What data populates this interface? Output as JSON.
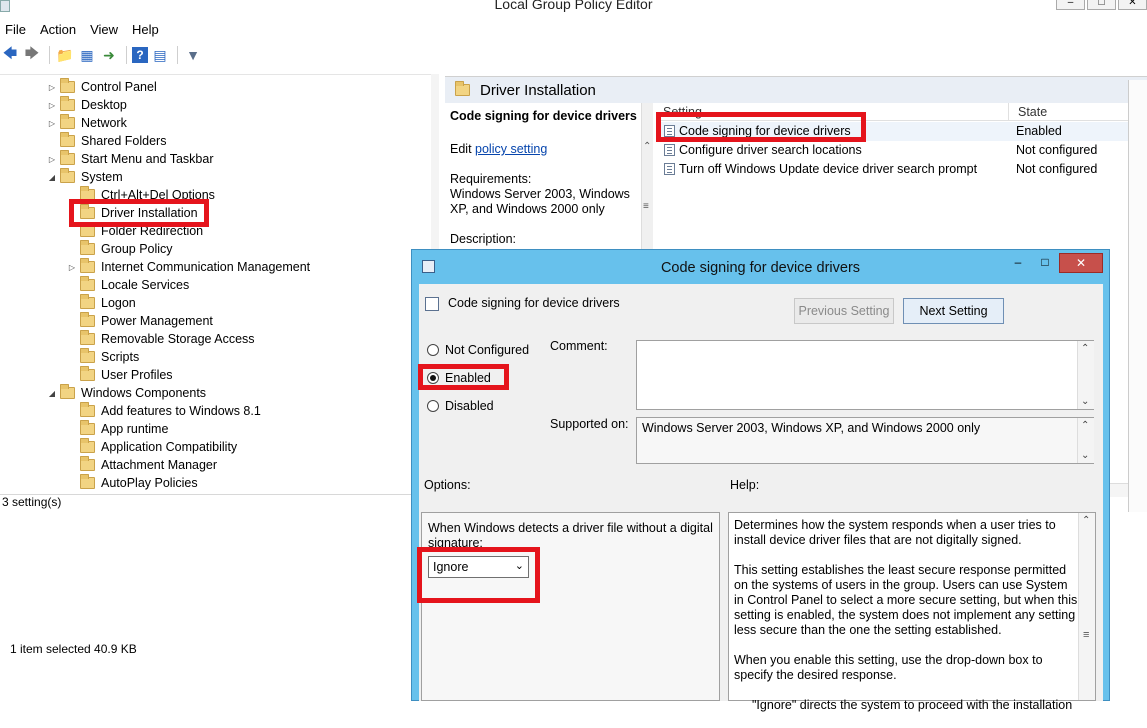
{
  "window": {
    "title": "Local Group Policy Editor"
  },
  "menu": [
    "File",
    "Action",
    "View",
    "Help"
  ],
  "tree": {
    "items": [
      {
        "label": "Control Panel",
        "indent": 0,
        "arrow": "closed"
      },
      {
        "label": "Desktop",
        "indent": 0,
        "arrow": "closed"
      },
      {
        "label": "Network",
        "indent": 0,
        "arrow": "closed"
      },
      {
        "label": "Shared Folders",
        "indent": 0,
        "arrow": "none"
      },
      {
        "label": "Start Menu and Taskbar",
        "indent": 0,
        "arrow": "closed"
      },
      {
        "label": "System",
        "indent": 0,
        "arrow": "open"
      },
      {
        "label": "Ctrl+Alt+Del Options",
        "indent": 1,
        "arrow": "none"
      },
      {
        "label": "Driver Installation",
        "indent": 1,
        "arrow": "none"
      },
      {
        "label": "Folder Redirection",
        "indent": 1,
        "arrow": "none"
      },
      {
        "label": "Group Policy",
        "indent": 1,
        "arrow": "none"
      },
      {
        "label": "Internet Communication Management",
        "indent": 1,
        "arrow": "closed"
      },
      {
        "label": "Locale Services",
        "indent": 1,
        "arrow": "none"
      },
      {
        "label": "Logon",
        "indent": 1,
        "arrow": "none"
      },
      {
        "label": "Power Management",
        "indent": 1,
        "arrow": "none"
      },
      {
        "label": "Removable Storage Access",
        "indent": 1,
        "arrow": "none"
      },
      {
        "label": "Scripts",
        "indent": 1,
        "arrow": "none"
      },
      {
        "label": "User Profiles",
        "indent": 1,
        "arrow": "none"
      },
      {
        "label": "Windows Components",
        "indent": 0,
        "arrow": "open"
      },
      {
        "label": "Add features to Windows 8.1",
        "indent": 1,
        "arrow": "none"
      },
      {
        "label": "App runtime",
        "indent": 1,
        "arrow": "none"
      },
      {
        "label": "Application Compatibility",
        "indent": 1,
        "arrow": "none"
      },
      {
        "label": "Attachment Manager",
        "indent": 1,
        "arrow": "none"
      },
      {
        "label": "AutoPlay Policies",
        "indent": 1,
        "arrow": "none"
      }
    ],
    "status": "3 setting(s)"
  },
  "right_pane": {
    "header": "Driver Installation",
    "desc_title": "Code signing for device drivers",
    "edit_prefix": "Edit",
    "edit_link": "policy setting",
    "requirements_label": "Requirements:",
    "requirements_text": "Windows Server 2003, Windows XP, and Windows 2000 only",
    "description_label": "Description:",
    "columns": {
      "setting": "Setting",
      "state": "State"
    },
    "rows": [
      {
        "name": "Code signing for device drivers",
        "state": "Enabled"
      },
      {
        "name": "Configure driver search locations",
        "state": "Not configured"
      },
      {
        "name": "Turn off Windows Update device driver search prompt",
        "state": "Not configured"
      }
    ]
  },
  "bottom_status": "1 item selected  40.9 KB",
  "dialog": {
    "title": "Code signing for device drivers",
    "heading": "Code signing for device drivers",
    "prev_button": "Previous Setting",
    "next_button": "Next Setting",
    "radio": {
      "not_configured": "Not Configured",
      "enabled": "Enabled",
      "disabled": "Disabled",
      "selected": "enabled"
    },
    "comment_label": "Comment:",
    "comment_value": "",
    "supported_label": "Supported on:",
    "supported_value": "Windows Server 2003, Windows XP, and Windows 2000 only",
    "options_label": "Options:",
    "help_label": "Help:",
    "option_text": "When Windows detects a driver file without a digital signature:",
    "option_select_value": "Ignore",
    "help_paragraphs": [
      "Determines how the system responds when a user tries to install device driver files that are not digitally signed.",
      "This setting establishes the least secure response permitted on the systems of users in the group. Users can use System in Control Panel to select a more secure setting, but when this setting is enabled, the system does not implement any setting less secure than the one the setting established.",
      "When you enable this setting, use the drop-down box to specify the desired response.",
      "\"Ignore\" directs the system to proceed with the installation"
    ]
  },
  "colors": {
    "highlight": "#e5141c",
    "dialog_frame": "#67c1ec",
    "close_button": "#c7504b",
    "link": "#0645ad"
  }
}
